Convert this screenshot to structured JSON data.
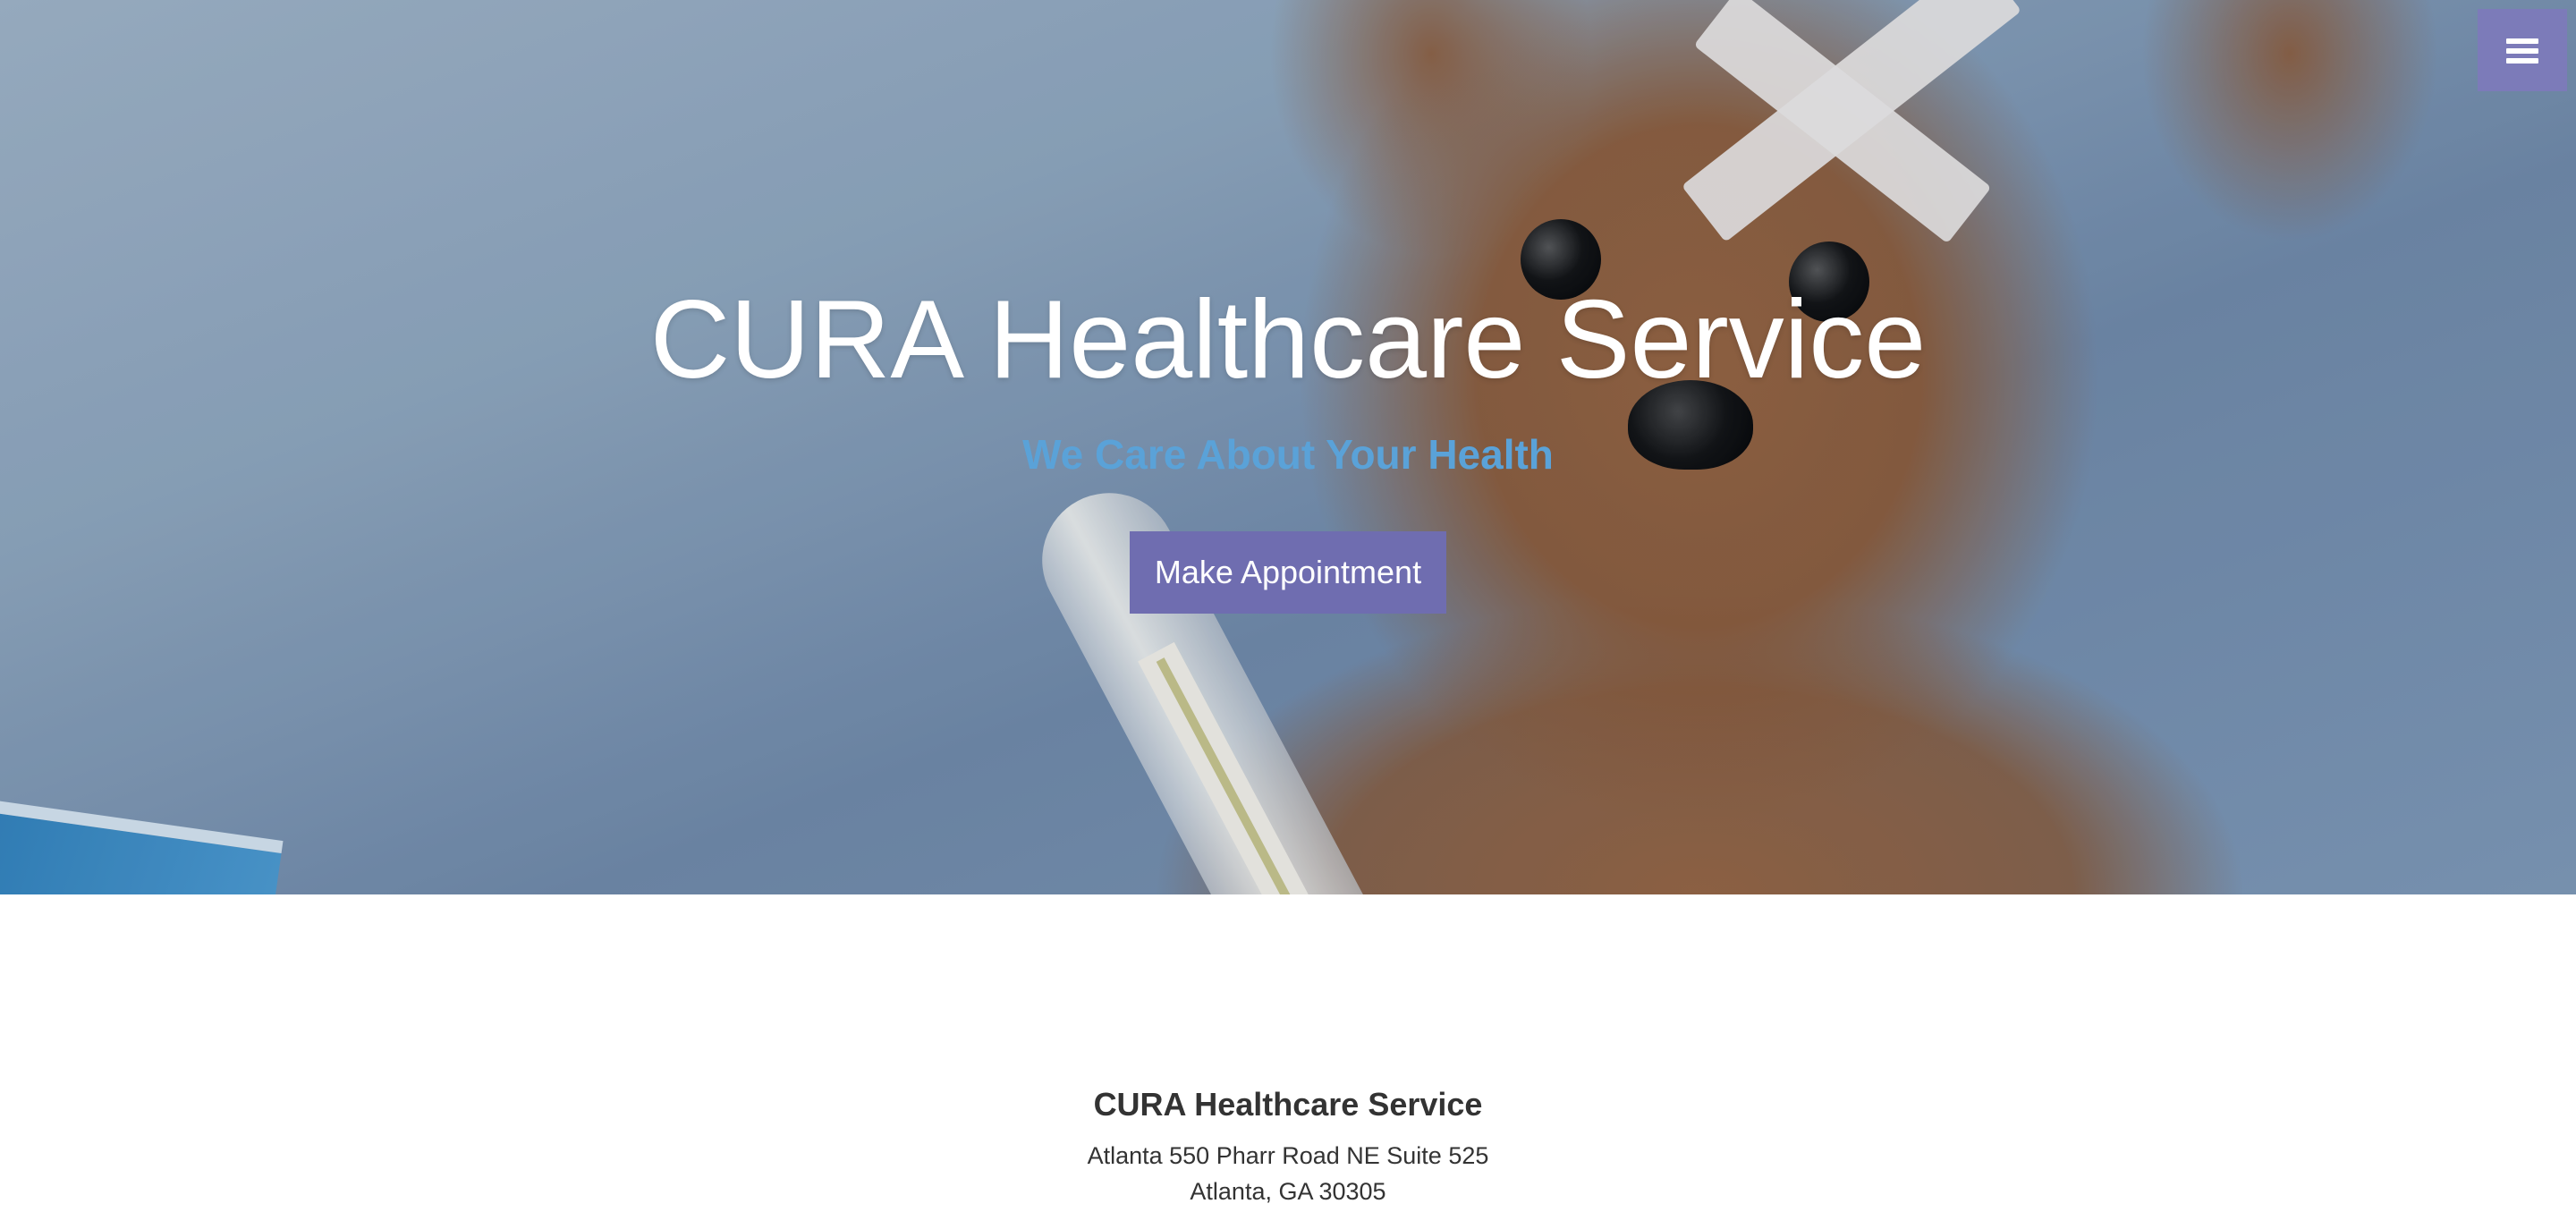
{
  "hero": {
    "title": "CURA Healthcare Service",
    "subtitle": "We Care About Your Health",
    "appointment_button": "Make Appointment"
  },
  "menu": {
    "icon": "hamburger-menu-icon"
  },
  "footer": {
    "title": "CURA Healthcare Service",
    "address_line1": "Atlanta 550 Pharr Road NE Suite 525",
    "address_line2": "Atlanta, GA 30305"
  },
  "colors": {
    "accent": "#6f6db0",
    "subtitle": "#5aa2d8",
    "menu_bg": "#7c7bb9",
    "text": "#333333"
  }
}
